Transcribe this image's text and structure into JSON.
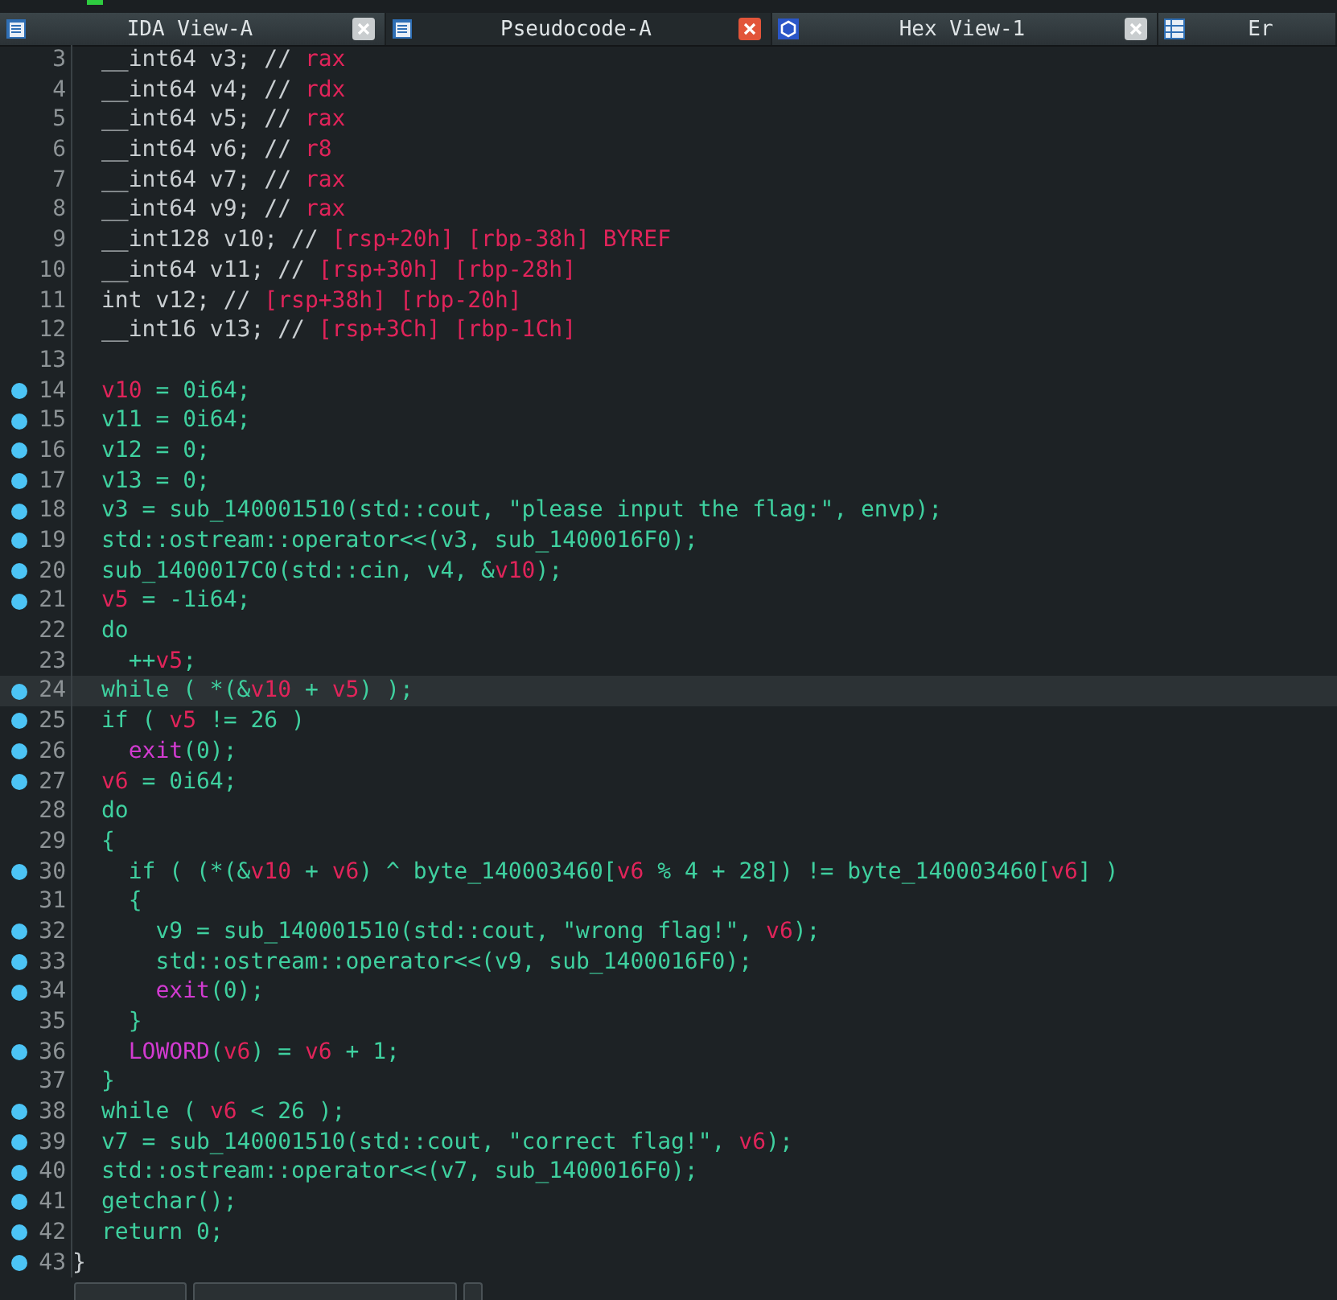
{
  "tabs": [
    {
      "label": "IDA View-A",
      "selected": false,
      "closable": true
    },
    {
      "label": "Pseudocode-A",
      "selected": true,
      "closable": true
    },
    {
      "label": "Hex View-1",
      "selected": false,
      "closable": true
    },
    {
      "label": "Er",
      "selected": false,
      "closable": false
    }
  ],
  "lines": [
    {
      "num": "3",
      "breakpoint": false,
      "current": false,
      "tokens": [
        {
          "kind": "plain",
          "text": "__int64 v3; // "
        },
        {
          "kind": "reg",
          "text": "rax"
        }
      ]
    },
    {
      "num": "4",
      "breakpoint": false,
      "current": false,
      "tokens": [
        {
          "kind": "plain",
          "text": "__int64 v4; // "
        },
        {
          "kind": "reg",
          "text": "rdx"
        }
      ]
    },
    {
      "num": "5",
      "breakpoint": false,
      "current": false,
      "tokens": [
        {
          "kind": "plain",
          "text": "__int64 v5; // "
        },
        {
          "kind": "reg",
          "text": "rax"
        }
      ]
    },
    {
      "num": "6",
      "breakpoint": false,
      "current": false,
      "tokens": [
        {
          "kind": "plain",
          "text": "__int64 v6; // "
        },
        {
          "kind": "reg",
          "text": "r8"
        }
      ]
    },
    {
      "num": "7",
      "breakpoint": false,
      "current": false,
      "tokens": [
        {
          "kind": "plain",
          "text": "__int64 v7; // "
        },
        {
          "kind": "reg",
          "text": "rax"
        }
      ]
    },
    {
      "num": "8",
      "breakpoint": false,
      "current": false,
      "tokens": [
        {
          "kind": "plain",
          "text": "__int64 v9; // "
        },
        {
          "kind": "reg",
          "text": "rax"
        }
      ]
    },
    {
      "num": "9",
      "breakpoint": false,
      "current": false,
      "tokens": [
        {
          "kind": "plain",
          "text": "__int128 v10; // "
        },
        {
          "kind": "reg",
          "text": "[rsp+20h] [rbp-38h] BYREF"
        }
      ]
    },
    {
      "num": "10",
      "breakpoint": false,
      "current": false,
      "tokens": [
        {
          "kind": "plain",
          "text": "__int64 v11; // "
        },
        {
          "kind": "reg",
          "text": "[rsp+30h] [rbp-28h]"
        }
      ]
    },
    {
      "num": "11",
      "breakpoint": false,
      "current": false,
      "tokens": [
        {
          "kind": "plain",
          "text": "int v12; // "
        },
        {
          "kind": "reg",
          "text": "[rsp+38h] [rbp-20h]"
        }
      ]
    },
    {
      "num": "12",
      "breakpoint": false,
      "current": false,
      "tokens": [
        {
          "kind": "plain",
          "text": "__int16 v13; // "
        },
        {
          "kind": "reg",
          "text": "[rsp+3Ch] [rbp-1Ch]"
        }
      ]
    },
    {
      "num": "13",
      "breakpoint": false,
      "current": false
    },
    {
      "num": "14",
      "breakpoint": true,
      "current": false,
      "tokens": [
        {
          "kind": "var",
          "text": "v10"
        },
        {
          "kind": "code",
          "text": " = 0i64;"
        }
      ]
    },
    {
      "num": "15",
      "breakpoint": true,
      "current": false,
      "tokens": [
        {
          "kind": "code",
          "text": "v11 = 0i64;"
        }
      ]
    },
    {
      "num": "16",
      "breakpoint": true,
      "current": false,
      "tokens": [
        {
          "kind": "code",
          "text": "v12 = 0;"
        }
      ]
    },
    {
      "num": "17",
      "breakpoint": true,
      "current": false,
      "tokens": [
        {
          "kind": "code",
          "text": "v13 = 0;"
        }
      ]
    },
    {
      "num": "18",
      "breakpoint": true,
      "current": false,
      "tokens": [
        {
          "kind": "code",
          "text": "v3 = sub_140001510(std::cout, \"please input the flag:\", envp);"
        }
      ]
    },
    {
      "num": "19",
      "breakpoint": true,
      "current": false,
      "tokens": [
        {
          "kind": "code",
          "text": "std::ostream::operator<<(v3, sub_1400016F0);"
        }
      ]
    },
    {
      "num": "20",
      "breakpoint": true,
      "current": false,
      "tokens": [
        {
          "kind": "code",
          "text": "sub_1400017C0(std::cin, v4, &"
        },
        {
          "kind": "var",
          "text": "v10"
        },
        {
          "kind": "code",
          "text": ");"
        }
      ]
    },
    {
      "num": "21",
      "breakpoint": true,
      "current": false,
      "tokens": [
        {
          "kind": "var",
          "text": "v5"
        },
        {
          "kind": "code",
          "text": " = -1i64;"
        }
      ]
    },
    {
      "num": "22",
      "breakpoint": false,
      "current": false,
      "tokens": [
        {
          "kind": "code",
          "text": "do"
        }
      ]
    },
    {
      "num": "23",
      "breakpoint": false,
      "current": false,
      "tokens": [
        {
          "kind": "code",
          "text": "  ++"
        },
        {
          "kind": "var",
          "text": "v5"
        },
        {
          "kind": "code",
          "text": ";"
        }
      ]
    },
    {
      "num": "24",
      "breakpoint": true,
      "current": true,
      "tokens": [
        {
          "kind": "code",
          "text": "while ( *(&"
        },
        {
          "kind": "var",
          "text": "v10"
        },
        {
          "kind": "code",
          "text": " + "
        },
        {
          "kind": "var",
          "text": "v5"
        },
        {
          "kind": "code",
          "text": ") );"
        }
      ]
    },
    {
      "num": "25",
      "breakpoint": true,
      "current": false,
      "tokens": [
        {
          "kind": "code",
          "text": "if ( "
        },
        {
          "kind": "var",
          "text": "v5"
        },
        {
          "kind": "code",
          "text": " != 26 )"
        }
      ]
    },
    {
      "num": "26",
      "breakpoint": true,
      "current": false,
      "tokens": [
        {
          "kind": "func",
          "text": "  exit"
        },
        {
          "kind": "code",
          "text": "(0);"
        }
      ]
    },
    {
      "num": "27",
      "breakpoint": true,
      "current": false,
      "tokens": [
        {
          "kind": "var",
          "text": "v6"
        },
        {
          "kind": "code",
          "text": " = 0i64;"
        }
      ]
    },
    {
      "num": "28",
      "breakpoint": false,
      "current": false,
      "tokens": [
        {
          "kind": "code",
          "text": "do"
        }
      ]
    },
    {
      "num": "29",
      "breakpoint": false,
      "current": false,
      "tokens": [
        {
          "kind": "code",
          "text": "{"
        }
      ]
    },
    {
      "num": "30",
      "breakpoint": true,
      "current": false,
      "tokens": [
        {
          "kind": "code",
          "text": "  if ( (*(&"
        },
        {
          "kind": "var",
          "text": "v10"
        },
        {
          "kind": "code",
          "text": " + "
        },
        {
          "kind": "var",
          "text": "v6"
        },
        {
          "kind": "code",
          "text": ") ^ byte_140003460["
        },
        {
          "kind": "var",
          "text": "v6"
        },
        {
          "kind": "code",
          "text": " % 4 + 28]) != byte_140003460["
        },
        {
          "kind": "var",
          "text": "v6"
        },
        {
          "kind": "code",
          "text": "] )"
        }
      ]
    },
    {
      "num": "31",
      "breakpoint": false,
      "current": false,
      "tokens": [
        {
          "kind": "code",
          "text": "  {"
        }
      ]
    },
    {
      "num": "32",
      "breakpoint": true,
      "current": false,
      "tokens": [
        {
          "kind": "code",
          "text": "    v9 = sub_140001510(std::cout, \"wrong flag!\", "
        },
        {
          "kind": "var",
          "text": "v6"
        },
        {
          "kind": "code",
          "text": ");"
        }
      ]
    },
    {
      "num": "33",
      "breakpoint": true,
      "current": false,
      "tokens": [
        {
          "kind": "code",
          "text": "    std::ostream::operator<<(v9, sub_1400016F0);"
        }
      ]
    },
    {
      "num": "34",
      "breakpoint": true,
      "current": false,
      "tokens": [
        {
          "kind": "func",
          "text": "    exit"
        },
        {
          "kind": "code",
          "text": "(0);"
        }
      ]
    },
    {
      "num": "35",
      "breakpoint": false,
      "current": false,
      "tokens": [
        {
          "kind": "code",
          "text": "  }"
        }
      ]
    },
    {
      "num": "36",
      "breakpoint": true,
      "current": false,
      "tokens": [
        {
          "kind": "func",
          "text": "  LOWORD"
        },
        {
          "kind": "code",
          "text": "("
        },
        {
          "kind": "var",
          "text": "v6"
        },
        {
          "kind": "code",
          "text": ") = "
        },
        {
          "kind": "var",
          "text": "v6"
        },
        {
          "kind": "code",
          "text": " + 1;"
        }
      ]
    },
    {
      "num": "37",
      "breakpoint": false,
      "current": false,
      "tokens": [
        {
          "kind": "code",
          "text": "}"
        }
      ]
    },
    {
      "num": "38",
      "breakpoint": true,
      "current": false,
      "tokens": [
        {
          "kind": "code",
          "text": "while ( "
        },
        {
          "kind": "var",
          "text": "v6"
        },
        {
          "kind": "code",
          "text": " < 26 );"
        }
      ]
    },
    {
      "num": "39",
      "breakpoint": true,
      "current": false,
      "tokens": [
        {
          "kind": "code",
          "text": "v7 = sub_140001510(std::cout, \"correct flag!\", "
        },
        {
          "kind": "var",
          "text": "v6"
        },
        {
          "kind": "code",
          "text": ");"
        }
      ]
    },
    {
      "num": "40",
      "breakpoint": true,
      "current": false,
      "tokens": [
        {
          "kind": "code",
          "text": "std::ostream::operator<<(v7, sub_1400016F0);"
        }
      ]
    },
    {
      "num": "41",
      "breakpoint": true,
      "current": false,
      "tokens": [
        {
          "kind": "code",
          "text": "getchar();"
        }
      ]
    },
    {
      "num": "42",
      "breakpoint": true,
      "current": false,
      "tokens": [
        {
          "kind": "code",
          "text": "return 0;"
        }
      ]
    },
    {
      "num": "43",
      "breakpoint": true,
      "current": false,
      "tokens": [
        {
          "kind": "brace",
          "text": "}"
        }
      ]
    }
  ]
}
